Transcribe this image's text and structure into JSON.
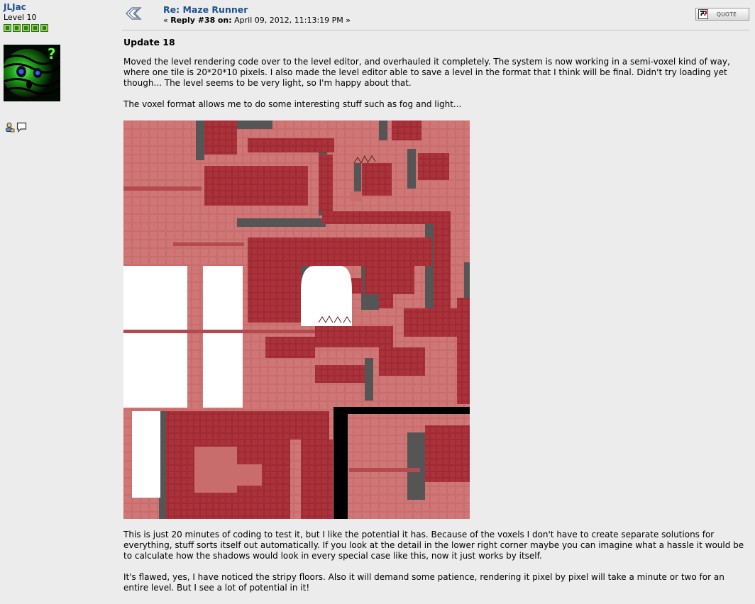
{
  "poster": {
    "name": "JLJac",
    "level": "Level 10",
    "star_count": 5,
    "avatar_icon": "green-glowing-face-avatar",
    "profile_icon": "person-icon",
    "message_icon": "speech-bubble-icon"
  },
  "post": {
    "title": "Re: Maze Runner",
    "meta_prefix": "«",
    "reply_label": "Reply #38",
    "on_label": "on:",
    "date": "April 09, 2012, 11:13:19 PM",
    "meta_suffix": "»",
    "quote_label": "QUOTE",
    "heading": "Update 18",
    "paragraphs": [
      "Moved the level rendering code over to the level editor, and overhauled it completely. The system is now working in a semi-voxel kind of way, where one tile is 20*20*10 pixels. I also made the level editor able to save a level in the format that I think will be final. Didn't try loading yet though... The level seems to be very light, so I'm happy about that.",
      "The voxel format allows me to do some interesting stuff such as fog and light..."
    ],
    "paragraphs_after": [
      "This is just 20 minutes of coding to test it, but I like the potential it has. Because of the voxels I don't have to create separate solutions for everything, stuff sorts itself out automatically. If you look at the detail in the lower right corner maybe you can imagine what a hassle it would be to calculate how the shadows would look in every special case like this, now it just works by itself.",
      "It's flawed, yes, I have noticed the stripy floors. Also it will demand some patience, rendering it pixel by pixel will take a minute or two for an entire level. But I see a lot of potential in it!"
    ],
    "image_subject": "voxel-rendered-red-maze-level"
  },
  "colors": {
    "link": "#1d4f8a",
    "background": "#ececec",
    "maze_floor": "#c66a6a",
    "maze_wall": "#a8303a",
    "maze_shadow": "#555555"
  }
}
